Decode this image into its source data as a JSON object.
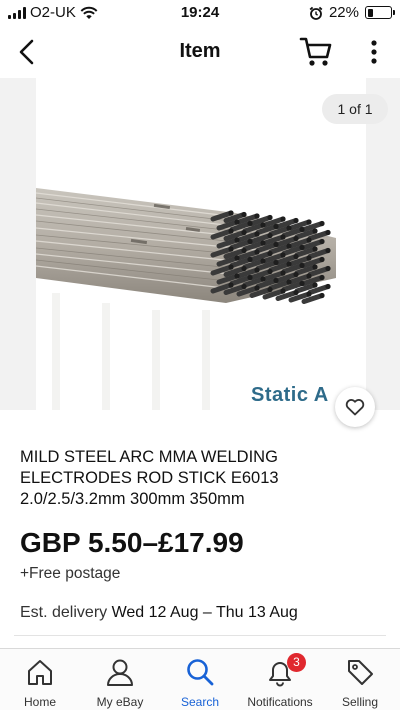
{
  "status_bar": {
    "carrier": "O2-UK",
    "time": "19:24",
    "battery_percent": "22%",
    "battery_level": 0.22
  },
  "nav": {
    "title": "Item",
    "icons": [
      "back-icon",
      "cart-icon",
      "more-icon"
    ]
  },
  "gallery": {
    "counter": "1 of 1",
    "watermark": "Static A"
  },
  "listing": {
    "title": "MILD STEEL ARC MMA WELDING ELECTRODES ROD STICK E6013 2.0/2.5/3.2mm 300mm 350mm",
    "price": "GBP 5.50–£17.99",
    "postage": "+Free postage",
    "delivery_label": "Est. delivery",
    "delivery_dates": "Wed 12 Aug – Thu 13 Aug"
  },
  "tab_bar": {
    "tabs": [
      {
        "label": "Home",
        "icon": "home-icon"
      },
      {
        "label": "My eBay",
        "icon": "person-icon"
      },
      {
        "label": "Search",
        "icon": "search-icon"
      },
      {
        "label": "Notifications",
        "icon": "bell-icon",
        "badge": "3"
      },
      {
        "label": "Selling",
        "icon": "tag-icon"
      }
    ],
    "active": "Search"
  },
  "colors": {
    "accent": "#1862d6",
    "badge": "#e0282e",
    "watermark": "#2e6b8a"
  }
}
